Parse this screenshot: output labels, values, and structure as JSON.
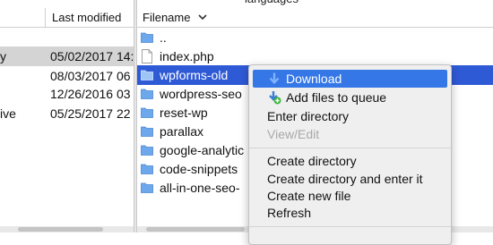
{
  "left_pane": {
    "column_last_modified": "Last modified",
    "rows": [
      {
        "name_fragment": "y",
        "date": "05/02/2017 14:",
        "selected": true
      },
      {
        "name_fragment": "",
        "date": "08/03/2017 06",
        "selected": false
      },
      {
        "name_fragment": "",
        "date": "12/26/2016 03",
        "selected": false
      },
      {
        "name_fragment": "ive",
        "date": "05/25/2017 22",
        "selected": false
      }
    ]
  },
  "right_pane": {
    "top_fragment": "languages",
    "column_filename": "Filename",
    "rows": [
      {
        "name": "..",
        "icon": "folder-icon",
        "selected": false
      },
      {
        "name": "index.php",
        "icon": "file-icon",
        "selected": false
      },
      {
        "name": "wpforms-old",
        "icon": "folder-icon",
        "selected": true
      },
      {
        "name": "wordpress-seo",
        "icon": "folder-icon",
        "selected": false
      },
      {
        "name": "reset-wp",
        "icon": "folder-icon",
        "selected": false
      },
      {
        "name": "parallax",
        "icon": "folder-icon",
        "selected": false
      },
      {
        "name": "google-analytic",
        "icon": "folder-icon",
        "selected": false
      },
      {
        "name": "code-snippets",
        "icon": "folder-icon",
        "selected": false
      },
      {
        "name": "all-in-one-seo-",
        "icon": "folder-icon",
        "selected": false
      }
    ]
  },
  "context_menu": {
    "items": [
      {
        "label": "Download",
        "icon": "download-arrow-icon",
        "highlighted": true
      },
      {
        "label": "Add files to queue",
        "icon": "add-to-queue-icon"
      },
      {
        "label": "Enter directory"
      },
      {
        "label": "View/Edit",
        "disabled": true
      },
      {
        "label": "Create directory"
      },
      {
        "label": "Create directory and enter it"
      },
      {
        "label": "Create new file"
      },
      {
        "label": "Refresh"
      }
    ]
  },
  "colors": {
    "selection_blue": "#2f5ad6",
    "menu_highlight": "#3577e6",
    "folder_blue": "#6ea8ec"
  }
}
